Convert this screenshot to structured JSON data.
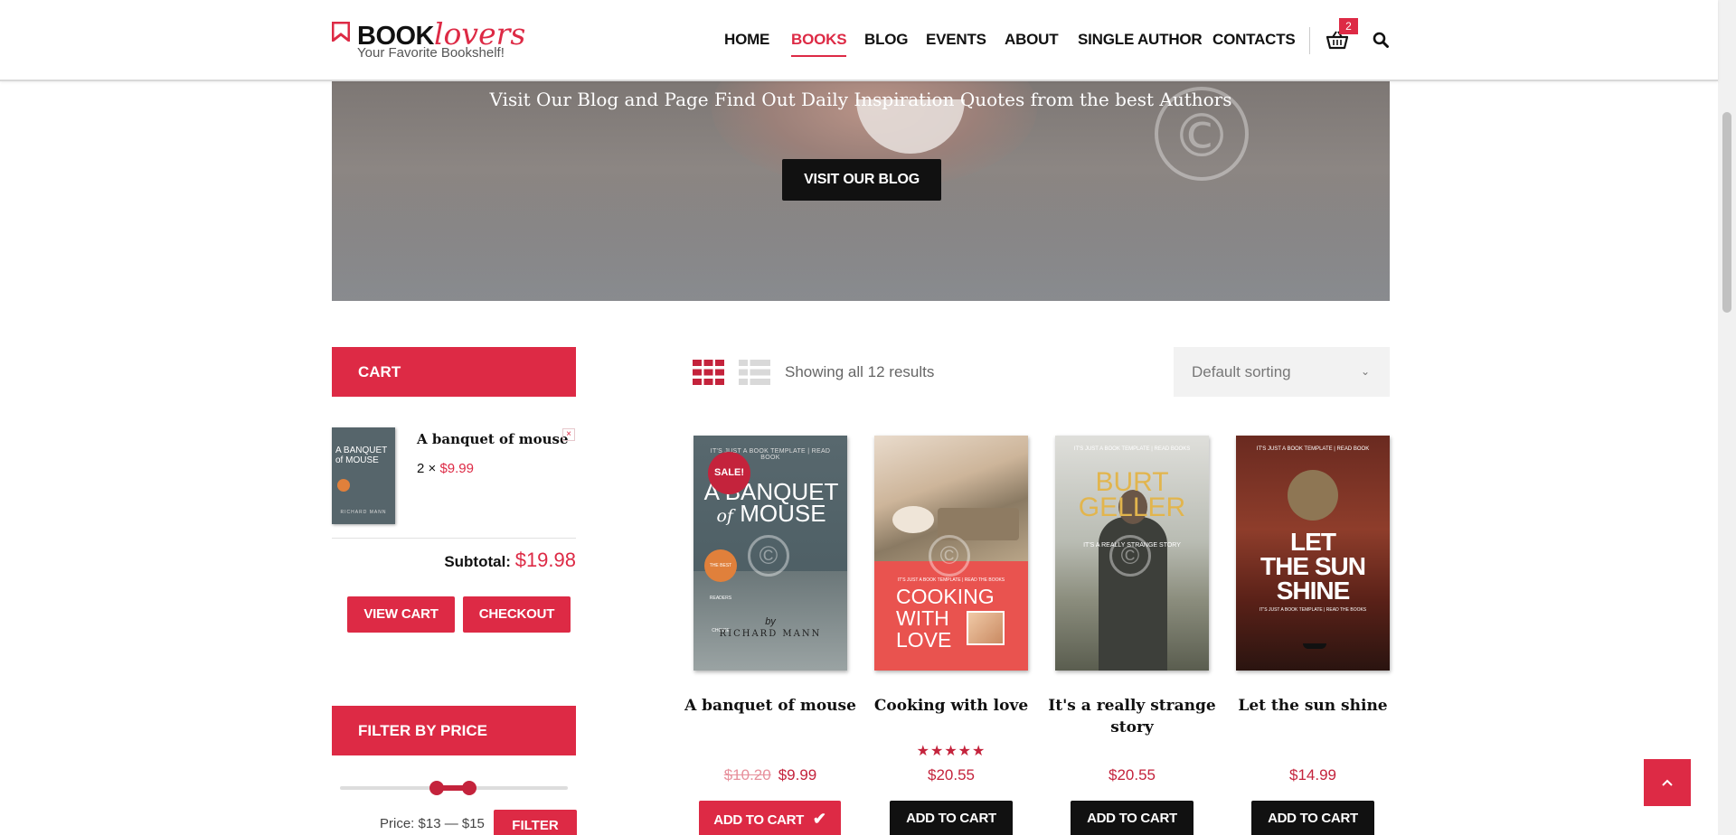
{
  "header": {
    "logo_book": "BOOK",
    "logo_lovers": "lovers",
    "tagline": "Your Favorite Bookshelf!",
    "nav": [
      {
        "label": "HOME",
        "active": false
      },
      {
        "label": "BOOKS",
        "active": true
      },
      {
        "label": "BLOG",
        "active": false
      },
      {
        "label": "EVENTS",
        "active": false
      },
      {
        "label": "ABOUT",
        "active": false
      },
      {
        "label": "SINGLE AUTHOR",
        "active": false
      },
      {
        "label": "CONTACTS",
        "active": false
      }
    ],
    "cart_count": "2",
    "cart_icon": "shopping-basket-icon",
    "search_icon": "search-icon"
  },
  "hero": {
    "text": "Visit Our Blog and Page Find Out Daily Inspiration Quotes from the best Authors",
    "button_label": "VISIT OUR BLOG"
  },
  "sidebar": {
    "cart_title": "CART",
    "cart_item": {
      "title": "A banquet of mouse",
      "qty": "2 ×",
      "price": "$9.99",
      "remove": "×",
      "cover_title": "A BANQUET of MOUSE",
      "cover_author": "RICHARD MANN"
    },
    "subtotal_label": "Subtotal:",
    "subtotal_value": "$19.98",
    "view_cart": "VIEW CART",
    "checkout": "CHECKOUT",
    "filter_title": "FILTER BY PRICE",
    "price_label": "Price: $13 — $15",
    "filter_button": "FILTER"
  },
  "toolbar": {
    "result_count": "Showing all 12 results",
    "sort_selected": "Default sorting",
    "grid_icon": "grid-view-icon",
    "list_icon": "list-view-icon"
  },
  "products": [
    {
      "title": "A banquet of mouse",
      "old_price": "$10.20",
      "price": "$9.99",
      "sale": "SALE!",
      "button": "ADD TO CART",
      "added": true,
      "cover": {
        "top": "IT'S JUST A BOOK TEMPLATE | READ BOOK",
        "line1": "A BANQUET",
        "line2": "of",
        "line3": "MOUSE",
        "badge": "THE BEST READERS CHOICE",
        "by": "by",
        "author": "RICHARD MANN"
      }
    },
    {
      "title": "Cooking with love",
      "price": "$20.55",
      "rating": "★★★★★",
      "button": "ADD TO CART",
      "added": false,
      "cover": {
        "sub": "IT'S JUST A BOOK TEMPLATE | READ THE BOOKS",
        "line1": "COOKING",
        "line2": "WITH",
        "line3": "LOVE"
      }
    },
    {
      "title": "It's a really strange story",
      "price": "$20.55",
      "button": "ADD TO CART",
      "added": false,
      "cover": {
        "top": "IT'S JUST A BOOK TEMPLATE | READ BOOKS",
        "line1": "BURT",
        "line2": "GELLER",
        "sub": "IT'S A REALLY STRANGE STORY"
      }
    },
    {
      "title": "Let the sun shine",
      "price": "$14.99",
      "button": "ADD TO CART",
      "added": false,
      "cover": {
        "top": "IT'S JUST A BOOK TEMPLATE | READ BOOK",
        "line1": "LET",
        "line2": "THE SUN",
        "line3": "SHINE",
        "sub": "IT'S JUST A BOOK TEMPLATE | READ THE BOOKS"
      }
    }
  ],
  "colors": {
    "accent": "#dd2a45",
    "dark": "#111111"
  }
}
